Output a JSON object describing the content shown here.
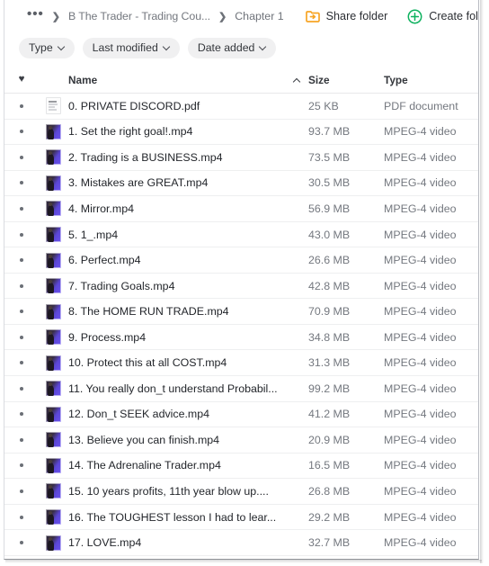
{
  "breadcrumb": {
    "overflow": "•••",
    "separator": "❯",
    "parent": "B The Trader - Trading Cou...",
    "current": "Chapter 1"
  },
  "toolbar": {
    "share_folder_label": "Share folder",
    "share_folder_icon": "share-folder-icon",
    "create_folder_label": "Create fol",
    "create_folder_icon": "plus-circle-icon"
  },
  "filters": [
    {
      "label": "Type",
      "icon": "chevron-down-icon"
    },
    {
      "label": "Last modified",
      "icon": "chevron-down-icon"
    },
    {
      "label": "Date added",
      "icon": "chevron-down-icon"
    }
  ],
  "table": {
    "headers": {
      "favorite": "♥",
      "name": "Name",
      "sort_indicator": "chevron-up-icon",
      "size": "Size",
      "type": "Type"
    },
    "rows": [
      {
        "name": "0. PRIVATE DISCORD.pdf",
        "size": "25 KB",
        "type": "PDF document",
        "icon": "pdf-file-icon"
      },
      {
        "name": "1. Set the right goal!.mp4",
        "size": "93.7 MB",
        "type": "MPEG-4 video",
        "icon": "video-thumbnail-icon"
      },
      {
        "name": "2. Trading is a BUSINESS.mp4",
        "size": "73.5 MB",
        "type": "MPEG-4 video",
        "icon": "video-thumbnail-icon"
      },
      {
        "name": "3. Mistakes are GREAT.mp4",
        "size": "30.5 MB",
        "type": "MPEG-4 video",
        "icon": "video-thumbnail-icon"
      },
      {
        "name": "4. Mirror.mp4",
        "size": "56.9 MB",
        "type": "MPEG-4 video",
        "icon": "video-thumbnail-icon"
      },
      {
        "name": "5. 1_.mp4",
        "size": "43.0 MB",
        "type": "MPEG-4 video",
        "icon": "video-thumbnail-icon"
      },
      {
        "name": "6. Perfect.mp4",
        "size": "26.6 MB",
        "type": "MPEG-4 video",
        "icon": "video-thumbnail-icon"
      },
      {
        "name": "7. Trading Goals.mp4",
        "size": "42.8 MB",
        "type": "MPEG-4 video",
        "icon": "video-thumbnail-icon"
      },
      {
        "name": "8. The HOME RUN TRADE.mp4",
        "size": "70.9 MB",
        "type": "MPEG-4 video",
        "icon": "video-thumbnail-icon"
      },
      {
        "name": "9. Process.mp4",
        "size": "34.8 MB",
        "type": "MPEG-4 video",
        "icon": "video-thumbnail-icon"
      },
      {
        "name": "10. Protect this at all COST.mp4",
        "size": "31.3 MB",
        "type": "MPEG-4 video",
        "icon": "video-thumbnail-icon"
      },
      {
        "name": "11. You really don_t understand Probabil...",
        "size": "99.2 MB",
        "type": "MPEG-4 video",
        "icon": "video-thumbnail-icon"
      },
      {
        "name": "12. Don_t SEEK advice.mp4",
        "size": "41.2 MB",
        "type": "MPEG-4 video",
        "icon": "video-thumbnail-icon"
      },
      {
        "name": "13. Believe you can finish.mp4",
        "size": "20.9 MB",
        "type": "MPEG-4 video",
        "icon": "video-thumbnail-icon"
      },
      {
        "name": "14. The Adrenaline Trader.mp4",
        "size": "16.5 MB",
        "type": "MPEG-4 video",
        "icon": "video-thumbnail-icon"
      },
      {
        "name": "15. 10 years profits, 11th year blow up....",
        "size": "26.8 MB",
        "type": "MPEG-4 video",
        "icon": "video-thumbnail-icon"
      },
      {
        "name": "16. The TOUGHEST lesson I had to lear...",
        "size": "29.2 MB",
        "type": "MPEG-4 video",
        "icon": "video-thumbnail-icon"
      },
      {
        "name": "17. LOVE.mp4",
        "size": "32.7 MB",
        "type": "MPEG-4 video",
        "icon": "video-thumbnail-icon"
      }
    ]
  },
  "colors": {
    "share_icon_orange": "#f5a623",
    "create_icon_green": "#0caa5a",
    "chip_background": "#f0f0f1",
    "text_primary": "#23262b",
    "text_muted": "#74787f"
  }
}
